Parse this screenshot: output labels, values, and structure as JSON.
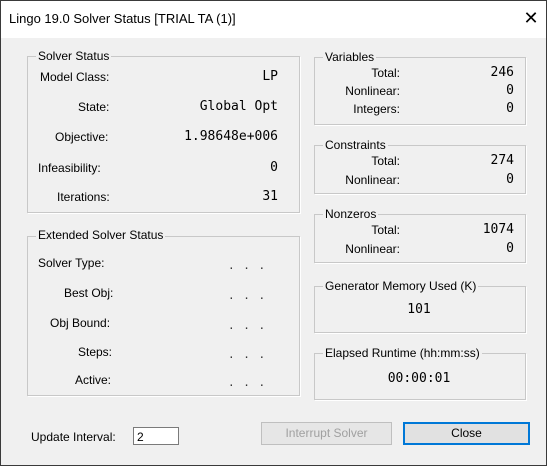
{
  "window": {
    "title": "Lingo 19.0 Solver Status [TRIAL TA (1)]",
    "close_glyph": "✕"
  },
  "solver_status": {
    "legend": "Solver Status",
    "model_class_label": "Model Class:",
    "model_class": "LP",
    "state_label": "State:",
    "state": "Global Opt",
    "objective_label": "Objective:",
    "objective": "1.98648e+006",
    "infeasibility_label": "Infeasibility:",
    "infeasibility": "0",
    "iterations_label": "Iterations:",
    "iterations": "31"
  },
  "extended_solver_status": {
    "legend": "Extended Solver Status",
    "solver_type_label": "Solver Type:",
    "best_obj_label": "Best Obj:",
    "obj_bound_label": "Obj Bound:",
    "steps_label": "Steps:",
    "active_label": "Active:",
    "empty_value": ". . ."
  },
  "variables": {
    "legend": "Variables",
    "total_label": "Total:",
    "total": "246",
    "nonlinear_label": "Nonlinear:",
    "nonlinear": "0",
    "integers_label": "Integers:",
    "integers": "0"
  },
  "constraints": {
    "legend": "Constraints",
    "total_label": "Total:",
    "total": "274",
    "nonlinear_label": "Nonlinear:",
    "nonlinear": "0"
  },
  "nonzeros": {
    "legend": "Nonzeros",
    "total_label": "Total:",
    "total": "1074",
    "nonlinear_label": "Nonlinear:",
    "nonlinear": "0"
  },
  "generator_memory": {
    "legend": "Generator Memory Used (K)",
    "value": "101"
  },
  "elapsed_runtime": {
    "legend": "Elapsed Runtime (hh:mm:ss)",
    "value": "00:00:01"
  },
  "footer": {
    "update_interval_label": "Update Interval:",
    "update_interval_value": "2",
    "interrupt_label": "Interrupt Solver",
    "close_label": "Close"
  },
  "colors": {
    "dialog_bg": "#f0f0f0",
    "title_bg": "#ffffff",
    "default_button_border": "#0078d7",
    "disabled_text": "#a0a0a0"
  }
}
